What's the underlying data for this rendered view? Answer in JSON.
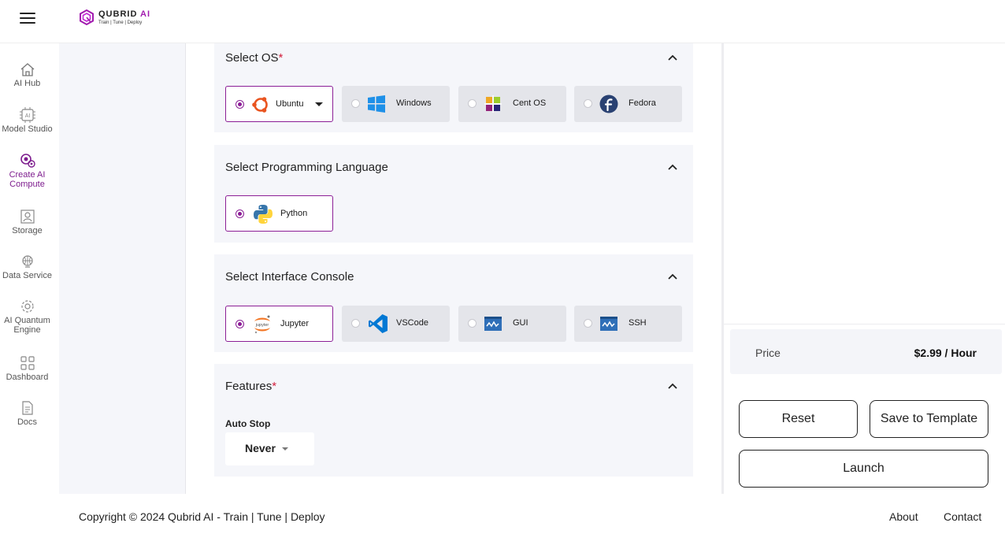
{
  "header": {
    "logo_name": "QUBRID",
    "logo_ai": "AI",
    "logo_tagline": "Train | Tune | Deploy"
  },
  "sidebar": {
    "items": [
      {
        "label": "AI Hub",
        "icon": "home-icon"
      },
      {
        "label": "Model Studio",
        "icon": "ai-chip-icon"
      },
      {
        "label": "Create AI Compute",
        "icon": "compute-icon",
        "active": true
      },
      {
        "label": "Storage",
        "icon": "storage-icon"
      },
      {
        "label": "Data Service",
        "icon": "data-service-icon"
      },
      {
        "label": "AI Quantum Engine",
        "icon": "quantum-icon"
      },
      {
        "label": "Dashboard",
        "icon": "grid-icon"
      },
      {
        "label": "Docs",
        "icon": "document-icon"
      }
    ]
  },
  "sections": {
    "os": {
      "title": "Select OS",
      "required": "*",
      "options": [
        {
          "label": "Ubuntu",
          "selected": true
        },
        {
          "label": "Windows",
          "selected": false
        },
        {
          "label": "Cent OS",
          "selected": false
        },
        {
          "label": "Fedora",
          "selected": false
        }
      ]
    },
    "language": {
      "title": "Select Programming Language",
      "options": [
        {
          "label": "Python",
          "selected": true
        }
      ]
    },
    "console": {
      "title": "Select Interface Console",
      "options": [
        {
          "label": "Jupyter",
          "selected": true
        },
        {
          "label": "VSCode",
          "selected": false
        },
        {
          "label": "GUI",
          "selected": false
        },
        {
          "label": "SSH",
          "selected": false
        }
      ]
    },
    "features": {
      "title": "Features",
      "required": "*",
      "autostop_label": "Auto Stop",
      "autostop_value": "Never"
    }
  },
  "summary": {
    "price_label": "Price",
    "price_value": "$2.99 / Hour",
    "reset_label": "Reset",
    "save_label": "Save to Template",
    "launch_label": "Launch"
  },
  "footer": {
    "copyright": "Copyright © 2024 Qubrid AI - Train | Tune | Deploy",
    "about": "About",
    "contact": "Contact"
  },
  "colors": {
    "accent": "#8b1e96",
    "required": "#d21f3c",
    "section_bg": "#f5f6fa",
    "option_bg": "#e4e5ea"
  }
}
